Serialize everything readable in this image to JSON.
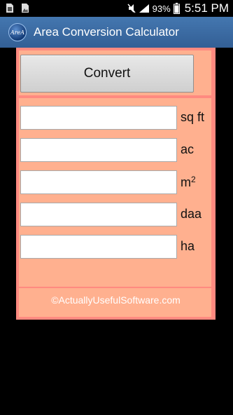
{
  "status_bar": {
    "battery_percent": "93%",
    "time": "5:51 PM"
  },
  "action_bar": {
    "icon_text": "AreA",
    "title": "Area Conversion Calculator"
  },
  "convert": {
    "label": "Convert"
  },
  "fields": [
    {
      "unit": "sq ft",
      "value": ""
    },
    {
      "unit": "ac",
      "value": ""
    },
    {
      "unit": "m",
      "unit_sup": "2",
      "value": ""
    },
    {
      "unit": "daa",
      "value": ""
    },
    {
      "unit": "ha",
      "value": ""
    }
  ],
  "footer": {
    "link_text": "©ActuallyUsefulSoftware.com"
  },
  "colors": {
    "panel_border": "#ff8a80",
    "panel_fill": "#ffb08f",
    "action_bar": "#3a6aa2"
  },
  "icons": {
    "status_left": [
      "sim-card-icon",
      "image-icon"
    ],
    "status_right": [
      "mute-icon",
      "signal-icon",
      "battery-icon"
    ]
  }
}
